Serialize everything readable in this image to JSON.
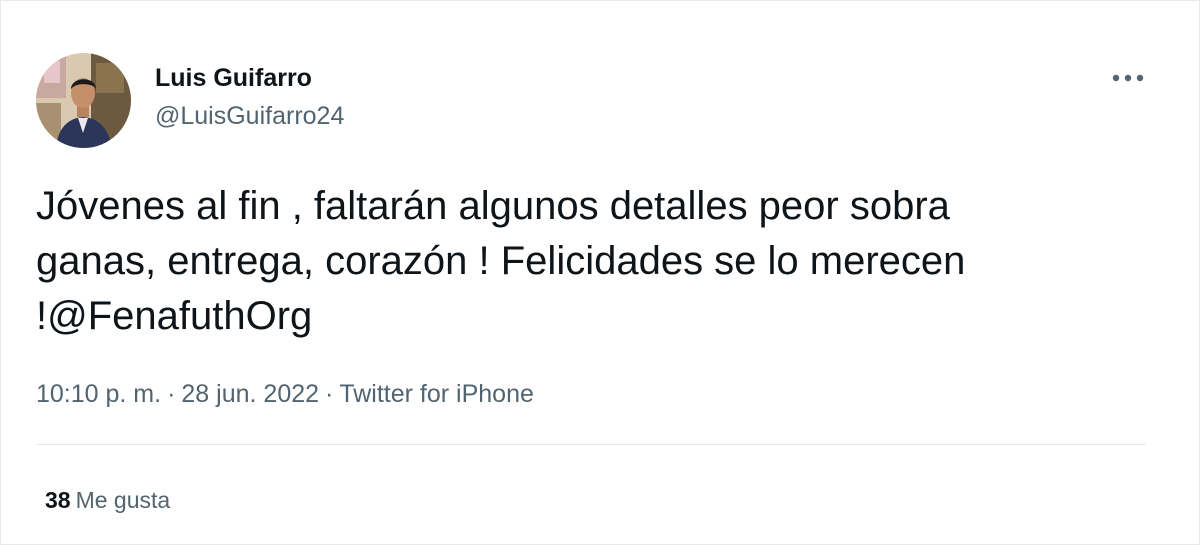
{
  "tweet": {
    "author": {
      "name": "Luis Guifarro",
      "handle": "@LuisGuifarro24",
      "avatar_icon": "profile-photo"
    },
    "more_icon": "ellipsis-icon",
    "text_lines": [
      "Jóvenes al fin , faltarán algunos detalles peor sobra",
      "ganas, entrega, corazón ! Felicidades se lo merecen",
      "!@FenafuthOrg"
    ],
    "meta": {
      "time": "10:10 p. m.",
      "separator": "·",
      "date": "28 jun. 2022",
      "source": "Twitter for iPhone"
    },
    "likes": {
      "count": "38",
      "label": "Me gusta"
    }
  },
  "colors": {
    "text_primary": "#0f1419",
    "text_secondary": "#536471",
    "divider": "#e7e9ea",
    "background": "#ffffff"
  }
}
